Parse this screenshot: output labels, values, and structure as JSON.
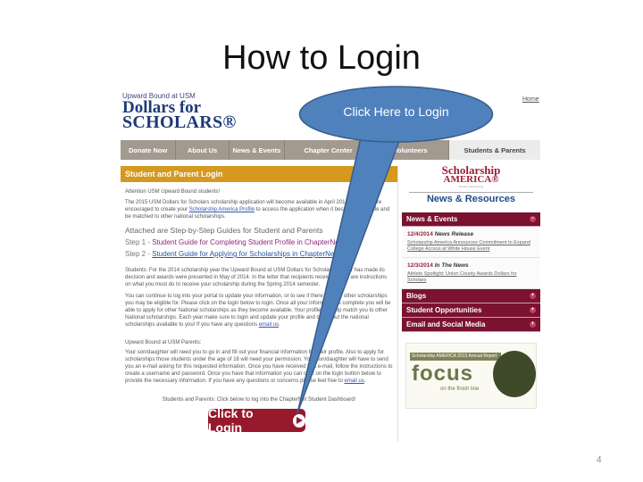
{
  "slide": {
    "title": "How to Login",
    "page_number": "4"
  },
  "callout": {
    "text": "Click Here to Login",
    "color": "#4f81bd"
  },
  "website": {
    "logo_small": "Upward Bound at USM",
    "logo_line1": "Dollars for",
    "logo_line2": "SCHOLARS®",
    "home_link": "Home",
    "nav": [
      {
        "label": "Donate Now"
      },
      {
        "label": "About Us"
      },
      {
        "label": "News & Events"
      },
      {
        "label": "Chapter Center"
      },
      {
        "label": "Volunteers"
      },
      {
        "label": "Students & Parents"
      }
    ],
    "login_section": {
      "header": "Student and Parent Login",
      "attention": "Attention USM Upward Bound students!",
      "intro_before_link": "The 2015 USM Dollars for Scholars scholarship application will become available in April 2014. Students are encouraged to create your ",
      "intro_link": "Scholarship America Profile",
      "intro_after_link": " to access the application when it becomes available and be matched to other national scholarships.",
      "attached_heading": "Attached are Step-by-Step Guides for Student and Parents",
      "step1_prefix": "Step 1 - ",
      "step1_link": "Student Guide for Completing Student Profile in ChapterNet",
      "step2_prefix": "Step 2 - ",
      "step2_link": "Student Guide for Applying for Scholarships in ChapterNet",
      "students_para": "Students: For the 2014 scholarship year the Upward Bound at USM Dollars for Scholars chapter has made its decision and awards were presented in May of 2014. In the letter that recipients received there are instructions on what you must do to receive your scholarship during the Spring 2014 semester.",
      "continue_para": "You can continue to log into your portal to update your information, or to see if there are any other scholarships you may be eligible for. Please click on the login below to login. Once all your information is complete you will be able to apply for other National scholarships as they become available. Your profile will help match you to other National scholarships. Each year make sure to login and update your profile and check out the national scholarships available to you! If you have any questions ",
      "continue_link": "email us",
      "parents_heading": "Upward Bound at USM Parents:",
      "parents_para": "Your son/daughter will need you to go in and fill out your financial information for their profile. Also to apply for scholarships those students under the age of 18 will need your permission. Your son/daughter will have to send you an e-mail asking for this requested information. Once you have received that e-mail, follow the instructions to create a username and password. Once you have that information you can click on the login button below to provide the necessary information. If you have any questions or concerns please feel free to ",
      "parents_link": "email us",
      "click_below_note": "Students and Parents: Click below to log into the ChapterNet Student Dashboard!",
      "login_button": "Click to Login"
    },
    "sidebar": {
      "sa_logo_line1": "Scholarship",
      "sa_logo_line2": "AMERICA®",
      "sa_tagline": "Dreams Need Doing",
      "news_resources": "News & Resources",
      "news_events_label": "News & Events",
      "news_events_toggle": "−",
      "news_items": [
        {
          "date": "12/4/2014",
          "type": "News Release",
          "text": "Scholarship America Announces Commitment to Expand College Access at White House Event"
        },
        {
          "date": "12/3/2014",
          "type": "In The News",
          "text": "Athlete Spotlight: Union County Awards Dollars for Scholars"
        }
      ],
      "bars": [
        {
          "label": "Blogs",
          "toggle": "+"
        },
        {
          "label": "Student Opportunities",
          "toggle": "+"
        },
        {
          "label": "Email and Social Media",
          "toggle": "+"
        }
      ],
      "report": {
        "header": "Scholarship AMERICA 2013 Annual Report",
        "word": "focus",
        "subtitle": "on the finish line"
      }
    }
  }
}
